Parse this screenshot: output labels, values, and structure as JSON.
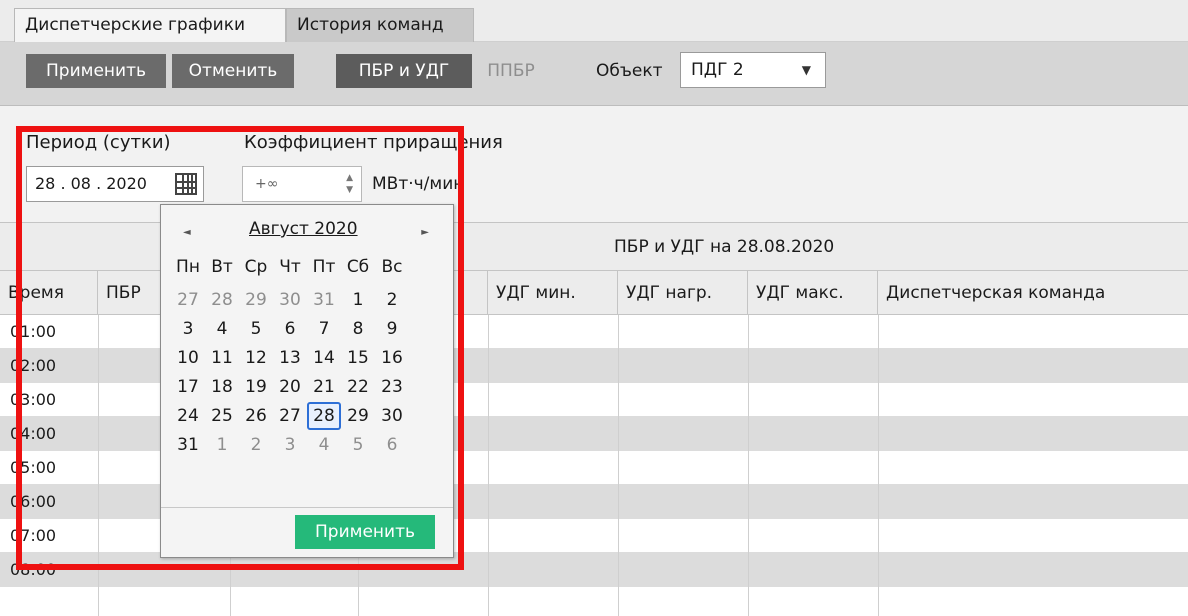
{
  "tabs": {
    "active": "Диспетчерские графики",
    "inactive": "История команд"
  },
  "toolbar": {
    "apply_label": "Применить",
    "cancel_label": "Отменить",
    "mode_active": "ПБР и УДГ",
    "mode_inactive": "ППБР",
    "object_label": "Объект",
    "object_value": "ПДГ 2"
  },
  "filters": {
    "period_label": "Период (сутки)",
    "period_value": "28 . 08 . 2020",
    "coef_label": "Коэффициент приращения",
    "coef_value": "+∞",
    "unit": "МВт·ч/мин"
  },
  "table": {
    "title": "ПБР и УДГ на 28.08.2020",
    "columns": [
      "Время",
      "ПБР",
      "",
      "",
      "УДГ мин.",
      "УДГ нагр.",
      "УДГ макс.",
      "Диспетчерская команда"
    ],
    "times": [
      "01:00",
      "02:00",
      "03:00",
      "04:00",
      "05:00",
      "06:00",
      "07:00",
      "08:00"
    ]
  },
  "calendar": {
    "month_title": "Август 2020",
    "weekdays": [
      "Пн",
      "Вт",
      "Ср",
      "Чт",
      "Пт",
      "Сб",
      "Вс"
    ],
    "weeks": [
      [
        "27",
        "28",
        "29",
        "30",
        "31",
        "1",
        "2"
      ],
      [
        "3",
        "4",
        "5",
        "6",
        "7",
        "8",
        "9"
      ],
      [
        "10",
        "11",
        "12",
        "13",
        "14",
        "15",
        "16"
      ],
      [
        "17",
        "18",
        "19",
        "20",
        "21",
        "22",
        "23"
      ],
      [
        "24",
        "25",
        "26",
        "27",
        "28",
        "29",
        "30"
      ],
      [
        "31",
        "1",
        "2",
        "3",
        "4",
        "5",
        "6"
      ]
    ],
    "selected_day": "28",
    "apply_label": "Применить",
    "apply_color": "#25b97a",
    "selected_color": "#2d6fd6"
  },
  "highlight_color": "#ee1111"
}
